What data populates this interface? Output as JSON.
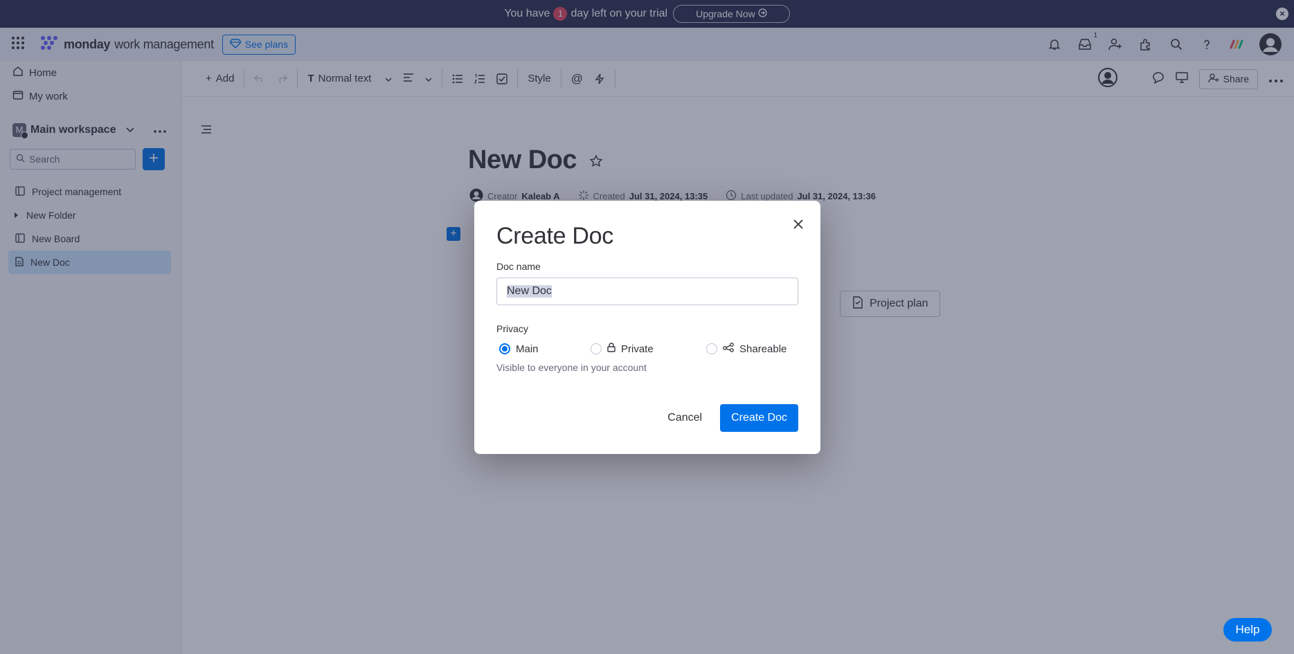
{
  "banner": {
    "text_before": "You have",
    "days": "1",
    "text_after": "day left on your trial",
    "upgrade_label": "Upgrade Now"
  },
  "header": {
    "brand": "monday",
    "product": "work management",
    "see_plans": "See plans",
    "inbox_count": "1"
  },
  "sidebar": {
    "home": "Home",
    "my_work": "My work",
    "workspace_initial": "M",
    "workspace_name": "Main workspace",
    "search_placeholder": "Search",
    "items": [
      {
        "label": "Project management",
        "icon": "board-icon"
      },
      {
        "label": "New Folder",
        "icon": "folder-caret-icon"
      },
      {
        "label": "New Board",
        "icon": "board-icon"
      },
      {
        "label": "New Doc",
        "icon": "doc-icon"
      }
    ]
  },
  "toolbar": {
    "add": "Add",
    "text_style": "Normal text",
    "style": "Style",
    "share": "Share"
  },
  "doc": {
    "title": "New Doc",
    "creator_label": "Creator",
    "creator": "Kaleab A",
    "created_label": "Created",
    "created": "Jul 31, 2024, 13:35",
    "updated_label": "Last updated",
    "updated": "Jul 31, 2024, 13:36",
    "template_project_plan": "Project plan"
  },
  "modal": {
    "title": "Create Doc",
    "name_label": "Doc name",
    "name_value": "New Doc",
    "privacy_label": "Privacy",
    "options": [
      "Main",
      "Private",
      "Shareable"
    ],
    "selected": "Main",
    "hint": "Visible to everyone in your account",
    "cancel": "Cancel",
    "submit": "Create Doc"
  },
  "help": "Help",
  "colors": {
    "primary": "#0073ea",
    "banner_bg": "#292f4c",
    "trial_badge": "#e2445c"
  }
}
